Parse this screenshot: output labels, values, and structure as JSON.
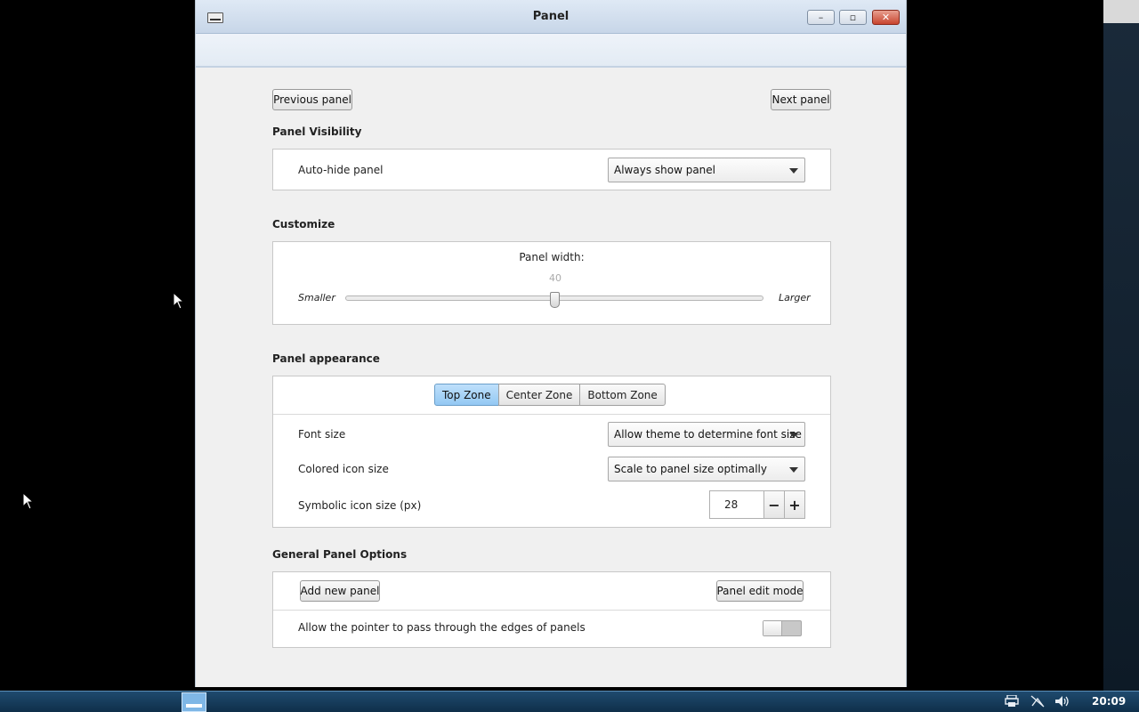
{
  "window": {
    "title": "Panel",
    "controls": {
      "minimize": "–",
      "maximize": "▫",
      "close": "✕"
    }
  },
  "nav": {
    "previous": "Previous panel",
    "next": "Next panel"
  },
  "visibility": {
    "title": "Panel Visibility",
    "autohide_label": "Auto-hide panel",
    "autohide_value": "Always show panel"
  },
  "customize": {
    "title": "Customize",
    "width_label": "Panel width:",
    "width_value": "40",
    "width_fraction": 0.5,
    "smaller": "Smaller",
    "larger": "Larger"
  },
  "appearance": {
    "title": "Panel appearance",
    "zones": [
      "Top Zone",
      "Center Zone",
      "Bottom Zone"
    ],
    "active_zone": "Top Zone",
    "font_size_label": "Font size",
    "font_size_value": "Allow theme to determine font size",
    "colored_icon_label": "Colored icon size",
    "colored_icon_value": "Scale to panel size optimally",
    "symbolic_icon_label": "Symbolic icon size (px)",
    "symbolic_icon_value": "28",
    "minus": "−",
    "plus": "+"
  },
  "general": {
    "title": "General Panel Options",
    "add_panel": "Add new panel",
    "edit_mode": "Panel edit mode",
    "pointer_pass_label": "Allow the pointer to pass through the edges of panels",
    "pointer_pass_enabled": false
  },
  "taskbar": {
    "clock": "20:09",
    "tray_icons": [
      "printer-icon",
      "network-disconnected-icon",
      "volume-icon"
    ]
  }
}
